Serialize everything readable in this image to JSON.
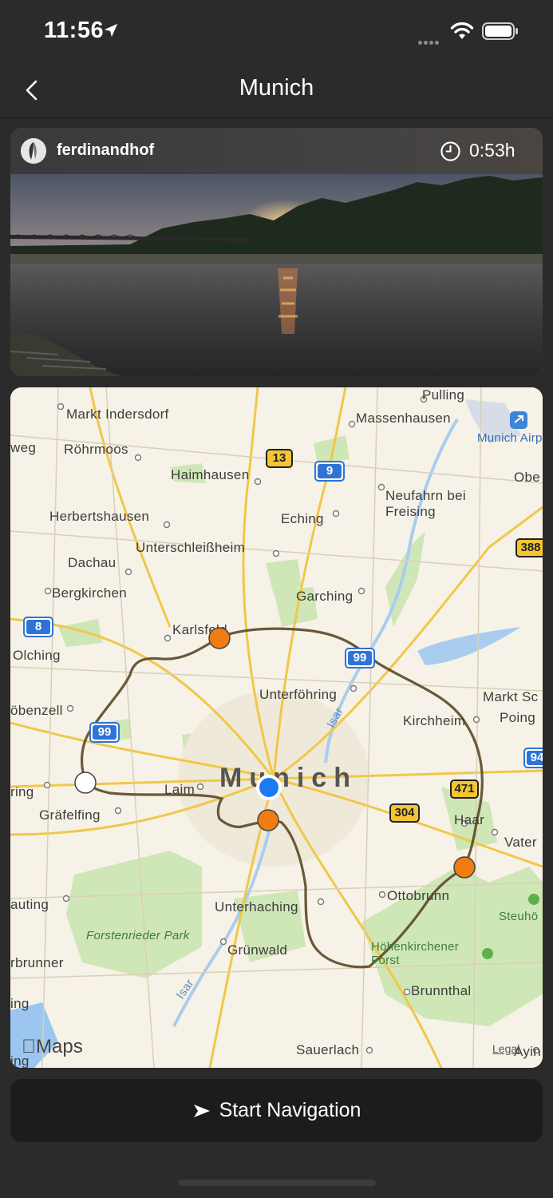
{
  "status_bar": {
    "time": "11:56",
    "icons": [
      "location-arrow-icon",
      "signal-icon",
      "wifi-icon",
      "battery-icon"
    ]
  },
  "nav": {
    "title": "Munich",
    "back_icon": "chevron-left-icon"
  },
  "post": {
    "username": "ferdinandhof",
    "duration": "0:53h",
    "clock_icon": "clock-icon"
  },
  "map": {
    "places": {
      "pulling": "Pulling",
      "markt_indersdorf": "Markt Indersdorf",
      "massenhausen": "Massenhausen",
      "munich_airport": "Munich Airport (MU",
      "weg": "weg",
      "roehrmoos": "Röhrmoos",
      "haimhausen": "Haimhausen",
      "ober": "Obe",
      "neufahrn": "Neufahrn bei Freising",
      "herbertshausen": "Herbertshausen",
      "eching": "Eching",
      "unterschleissheim": "Unterschleißheim",
      "dachau": "Dachau",
      "bergkirchen": "Bergkirchen",
      "garching": "Garching",
      "karlsfeld": "Karlsfeld",
      "olching": "Olching",
      "unterfoehring": "Unterföhring",
      "markt_schwaben": "Markt Sc",
      "poing": "Poing",
      "oebenzell": "öbenzell",
      "kirchheim": "Kirchheim",
      "isar_north": "Isar",
      "munich": "Munich",
      "laim": "Laim",
      "ring": "ring",
      "graefelfing": "Gräfelfing",
      "haar": "Haar",
      "vaterstetten": "Vater",
      "gauting": "auting",
      "unterhaching": "Unterhaching",
      "ottobrunn": "Ottobrunn",
      "steinhoering": "Steuhö",
      "forstenrieder_park": "Forstenrieder Park",
      "gruenwald": "Grünwald",
      "hoehenkirchener_forst": "Höhenkirchener Forst",
      "brbrunner": "rbrunner",
      "isar_south": "Isar",
      "brunnthal": "Brunnthal",
      "ng": "ing",
      "sauerlach": "Sauerlach",
      "aying": "Ayin",
      "ing_bottom": "ing"
    },
    "road_shields": {
      "r13": "13",
      "a9": "9",
      "r388": "388",
      "a8": "8",
      "a99_north": "99",
      "a99_west": "99",
      "a94": "94",
      "r471": "471",
      "r304": "304"
    },
    "maps_logo": "Maps",
    "legal": "Legal",
    "route_color": "#5a4826",
    "stop_color": "#f07c12",
    "current_location_color": "#1b7bf2",
    "start_marker_color": "#ffffff"
  },
  "actions": {
    "start_navigation": "Start Navigation",
    "start_navigation_icon": "navigation-arrow-icon"
  }
}
